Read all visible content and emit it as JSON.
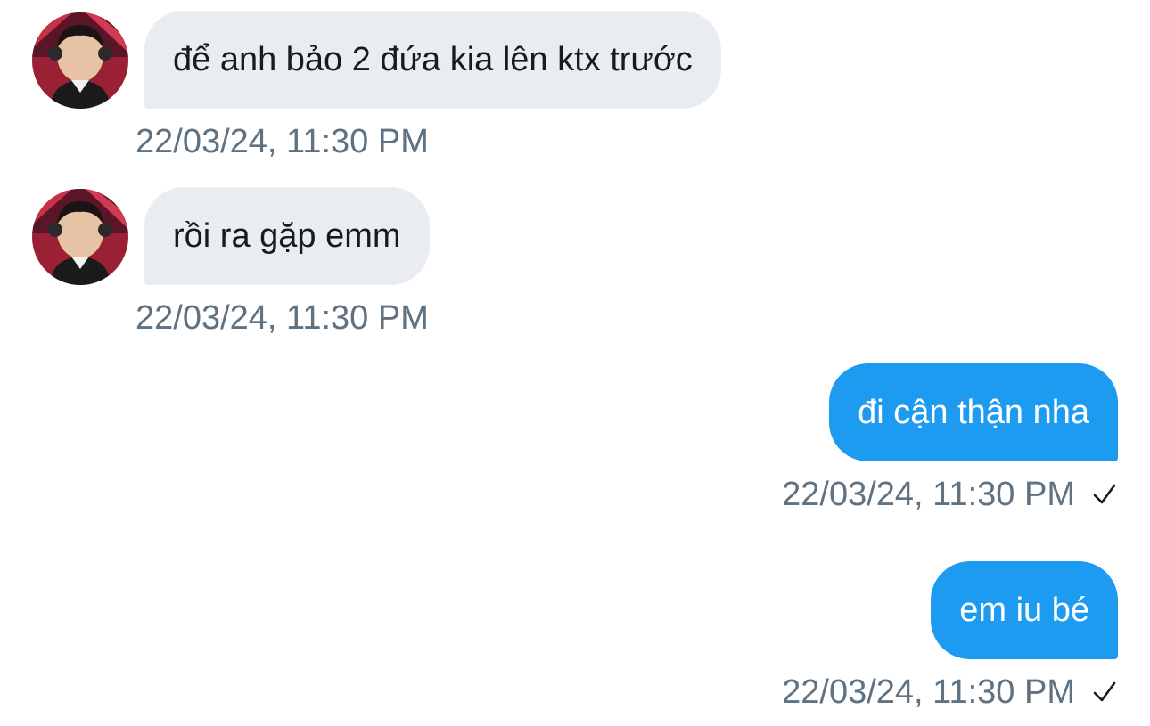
{
  "conversation": {
    "messages": [
      {
        "sender": "other",
        "text": "để anh bảo 2 đứa kia lên ktx trước",
        "timestamp": "22/03/24, 11:30 PM"
      },
      {
        "sender": "other",
        "text": "rồi ra gặp emm",
        "timestamp": "22/03/24, 11:30 PM"
      },
      {
        "sender": "me",
        "text": "đi cận thận nha",
        "timestamp": "22/03/24, 11:30 PM",
        "status_icon": "checkmark-icon"
      },
      {
        "sender": "me",
        "text": "em iu bé",
        "timestamp": "22/03/24, 11:30 PM",
        "status_icon": "checkmark-icon"
      }
    ]
  },
  "colors": {
    "incoming_bubble": "#e9edf1",
    "outgoing_bubble": "#1d9bf0",
    "timestamp_text": "#5f7282"
  }
}
